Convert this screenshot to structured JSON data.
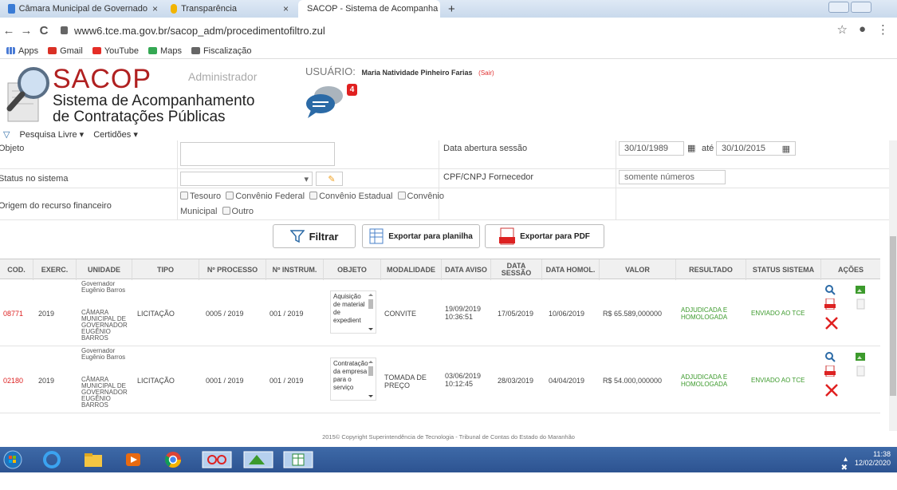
{
  "browser": {
    "tabs": [
      {
        "label": "Câmara Municipal de Governado",
        "close": "×"
      },
      {
        "label": "Transparência",
        "close": "×"
      },
      {
        "label": "SACOP - Sistema de Acompanha",
        "close": "×"
      }
    ],
    "new_tab": "+",
    "url": "www6.tce.ma.gov.br/sacop_adm/procedimentofiltro.zul",
    "back": "←",
    "forward": "→",
    "reload": "C",
    "star": "☆",
    "account": "●",
    "menu": "⋮",
    "bookmarks": [
      "Apps",
      "Gmail",
      "YouTube",
      "Maps",
      "Fiscalização"
    ]
  },
  "header": {
    "logo": "SACOP",
    "system_line1": "Sistema de Acompanhamento",
    "system_line2": "de Contratações Públicas",
    "role": "Administrador",
    "user_label": "USUÁRIO:",
    "user_name": "Maria Natividade Pinheiro Farias",
    "logout": "(Sair)",
    "notifications": "4"
  },
  "menu": {
    "items": [
      "Pesquisa Livre ▾",
      "Certidões ▾"
    ]
  },
  "filters": {
    "objeto_label": "Objeto",
    "status_label": "Status no sistema",
    "origem_label": "Origem do recurso financeiro",
    "data_label": "Data abertura sessão",
    "date_from": "30/10/1989",
    "ate": "até",
    "date_to": "30/10/2015",
    "cpf_label": "CPF/CNPJ Fornecedor",
    "cpf_placeholder": "somente números",
    "options": [
      "Tesouro",
      "Convênio Federal",
      "Convênio Estadual",
      "Convênio"
    ],
    "options2": [
      "Municipal",
      "Outro"
    ]
  },
  "actions": {
    "filter": "Filtrar",
    "export_sheet": "Exportar para planilha",
    "export_pdf": "Exportar para PDF"
  },
  "table": {
    "columns": [
      "COD.",
      "EXERC.",
      "UNIDADE",
      "TIPO",
      "Nº PROCESSO",
      "Nº INSTRUM.",
      "OBJETO",
      "MODALIDADE",
      "DATA AVISO",
      "DATA SESSÃO",
      "DATA HOMOL.",
      "VALOR",
      "RESULTADO",
      "STATUS SISTEMA",
      "AÇÕES"
    ],
    "rows": [
      {
        "cod": "08771",
        "exerc": "2019",
        "unidade_a": "Governador Eugênio Barros",
        "unidade_b": "CÂMARA MUNICIPAL DE GOVERNADOR EUGÊNIO BARROS",
        "tipo": "LICITAÇÃO",
        "processo": "0005 / 2019",
        "instrum": "001 / 2019",
        "objeto": "Aquisição de material de expedient",
        "modalidade": "CONVITE",
        "data_aviso": "19/09/2019 10:36:51",
        "data_sessao": "17/05/2019",
        "data_homol": "10/06/2019",
        "valor": "R$ 65.589,000000",
        "resultado": "ADJUDICADA E HOMOLOGADA",
        "status": "ENVIADO AO TCE"
      },
      {
        "cod": "02180",
        "exerc": "2019",
        "unidade_a": "Governador Eugênio Barros",
        "unidade_b": "CÂMARA MUNICIPAL DE GOVERNADOR EUGÊNIO BARROS",
        "tipo": "LICITAÇÃO",
        "processo": "0001 / 2019",
        "instrum": "001 / 2019",
        "objeto": "Contratação da empresa para o serviço",
        "modalidade": "TOMADA DE PREÇO",
        "data_aviso": "03/06/2019 10:12:45",
        "data_sessao": "28/03/2019",
        "data_homol": "04/04/2019",
        "valor": "R$ 54.000,000000",
        "resultado": "ADJUDICADA E HOMOLOGADA",
        "status": "ENVIADO AO TCE"
      }
    ]
  },
  "footer": "2015© Copyright  Superintendência de Tecnologia - Tribunal de Contas do Estado do Maranhão",
  "tray": {
    "time": "11:38",
    "date": "12/02/2020"
  },
  "colors": {
    "brand_red": "#b02020",
    "status_green": "#3c9a2c",
    "taskbar": "#2d5391"
  }
}
